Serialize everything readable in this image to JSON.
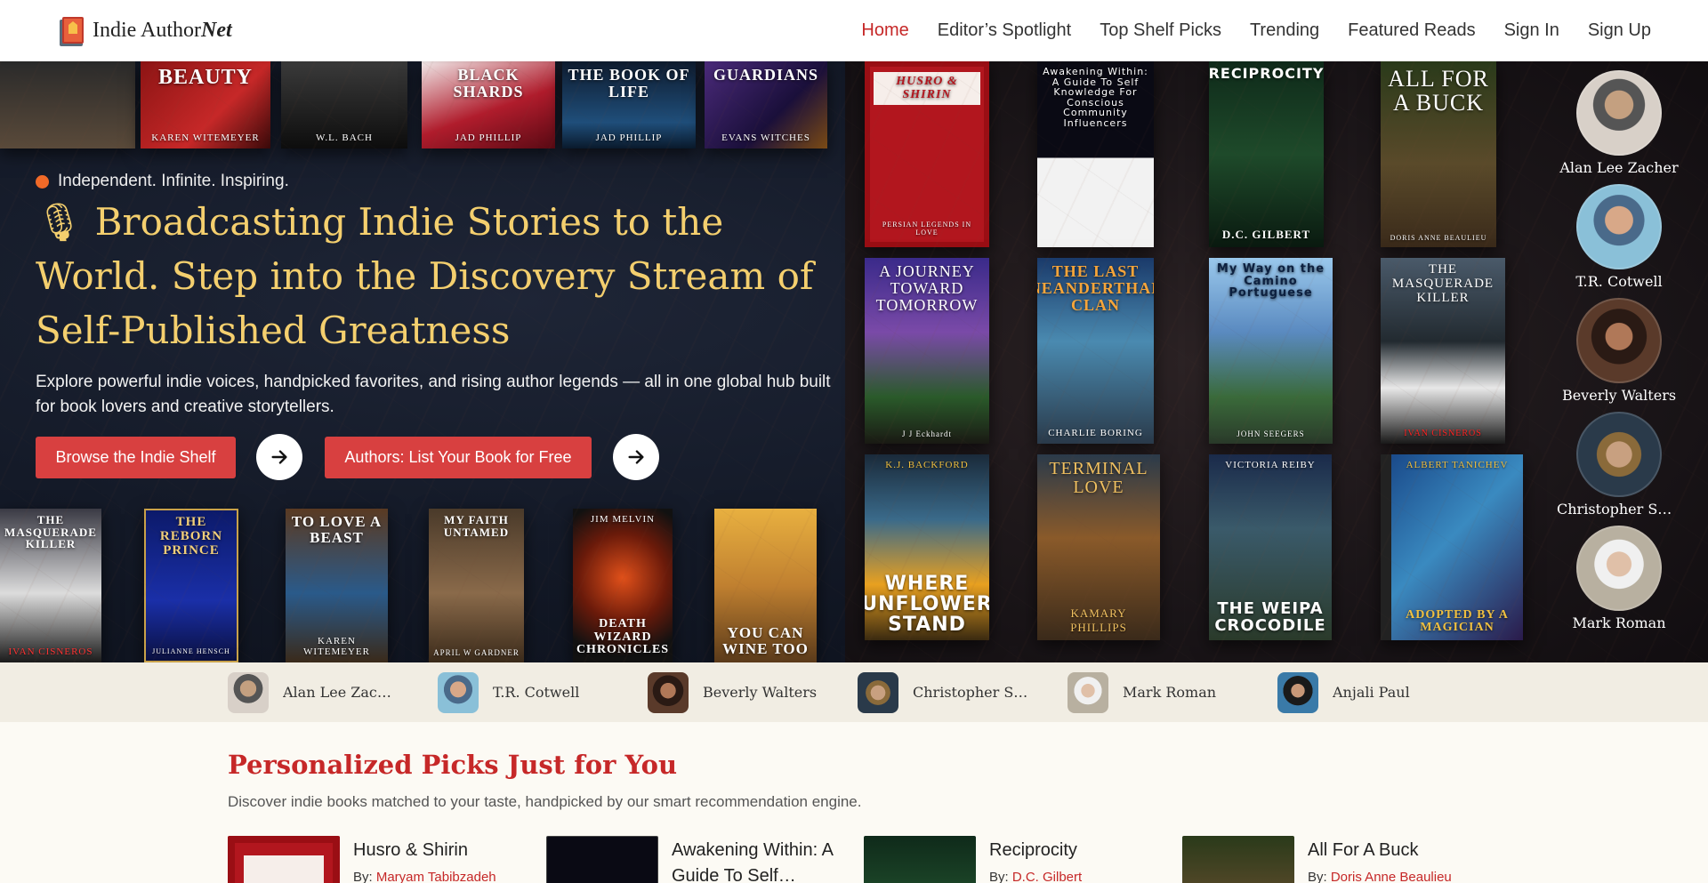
{
  "nav": {
    "brand_main": "Indie Author",
    "brand_accent": "Net",
    "links": [
      {
        "label": "Home",
        "active": true
      },
      {
        "label": "Editor’s Spotlight"
      },
      {
        "label": "Top Shelf Picks"
      },
      {
        "label": "Trending"
      },
      {
        "label": "Featured Reads"
      },
      {
        "label": "Sign In"
      },
      {
        "label": "Sign Up"
      }
    ]
  },
  "hero": {
    "tagline": "Independent. Infinite. Inspiring.",
    "headline": "🎙 Broadcasting Indie Stories to the World. Step into the Discovery Stream of Self-Published Greatness",
    "subtext": "Explore powerful indie voices, handpicked favorites, and rising author legends — all in one global hub built for book lovers and creative storytellers.",
    "primary_button": "Browse the Indie Shelf",
    "secondary_button": "Authors: List Your Book for Free",
    "top_books": [
      {
        "title": "",
        "author": ""
      },
      {
        "title": "Beauty",
        "author": "Karen Witemeyer"
      },
      {
        "title": "",
        "author": "W.L. Bach"
      },
      {
        "title": "Black Shards",
        "author": "Jad Phillip"
      },
      {
        "title": "The Book of Life",
        "author": "Jad Phillip"
      },
      {
        "title": "Guardians",
        "author": "Evans Witches"
      }
    ],
    "bottom_books": [
      {
        "title": "The Masquerade Killer",
        "author": "Ivan Cisneros"
      },
      {
        "title": "The Reborn Prince",
        "author": "Julianne Hensch"
      },
      {
        "title": "To Love a Beast",
        "author": "Karen Witemeyer"
      },
      {
        "title": "My Faith Untamed",
        "author": "April W Gardner"
      },
      {
        "title": "Death Wizard Chronicles",
        "author": "Jim Melvin"
      },
      {
        "title": "You Can Wine Too",
        "author": ""
      }
    ],
    "grid_books": [
      {
        "title": "Husro & Shirin",
        "author": "Persian Legends in Love"
      },
      {
        "title": "Awakening Within: A Guide To Self Knowledge For Conscious Community Influencers",
        "author": ""
      },
      {
        "title": "Reciprocity",
        "author": "D.C. Gilbert"
      },
      {
        "title": "All For A Buck",
        "author": "Doris Anne Beaulieu"
      },
      {
        "title": "A Journey Toward Tomorrow",
        "author": "J J Eckhardt"
      },
      {
        "title": "The Last Neanderthal Clan",
        "author": "Charlie Boring"
      },
      {
        "title": "My Way on the Camino Portuguese",
        "author": "John Seegers"
      },
      {
        "title": "The Masquerade Killer",
        "author": "Ivan Cisneros"
      },
      {
        "title": "Where Sunflowers Stand",
        "author": "K.J. Backford"
      },
      {
        "title": "Terminal Love",
        "author": "Kamary Phillips"
      },
      {
        "title": "The Weipa Crocodile",
        "author": "Victoria Reiby"
      },
      {
        "title": "Adopted by a Magician",
        "author": "Albert Tanichev"
      }
    ],
    "authors": [
      "Alan Lee Zacher",
      "T.R. Cotwell",
      "Beverly Walters",
      "Christopher Sm…",
      "Mark Roman"
    ]
  },
  "strip": {
    "authors": [
      "Alan Lee Zach…",
      "T.R. Cotwell",
      "Beverly Walters",
      "Christopher S…",
      "Mark Roman",
      "Anjali Paul"
    ]
  },
  "picks": {
    "title": "Personalized Picks Just for You",
    "subtitle": "Discover indie books matched to your taste, handpicked by our smart recommendation engine.",
    "by_label": "By: ",
    "items": [
      {
        "title": "Husro & Shirin",
        "author": "Maryam Tabibzadeh"
      },
      {
        "title": "Awakening Within: A Guide To Self…",
        "author": ""
      },
      {
        "title": "Reciprocity",
        "author": "D.C. Gilbert"
      },
      {
        "title": "All For A Buck",
        "author": "Doris Anne Beaulieu"
      }
    ]
  },
  "colors": {
    "accent_red": "#c62828",
    "button_red": "#d84040",
    "headline_gold": "#f4cf6e",
    "tagline_dot": "#f06a28"
  }
}
